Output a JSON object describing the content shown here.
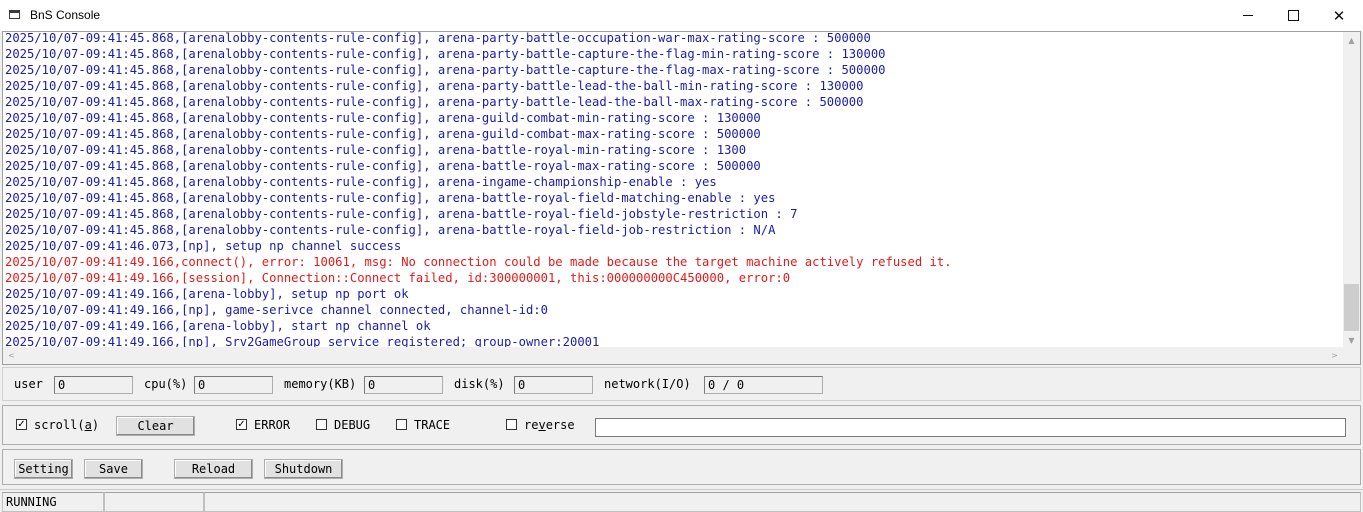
{
  "window": {
    "title": "BnS Console",
    "minimize_icon": "minimize-icon",
    "maximize_icon": "maximize-icon",
    "close_icon": "close-icon",
    "close_glyph": "✕"
  },
  "log": {
    "lines": [
      {
        "text": "2025/10/07-09:41:45.868,[arenalobby-contents-rule-config], arena-party-battle-occupation-war-max-rating-score : 500000",
        "level": "info"
      },
      {
        "text": "2025/10/07-09:41:45.868,[arenalobby-contents-rule-config], arena-party-battle-capture-the-flag-min-rating-score : 130000",
        "level": "info"
      },
      {
        "text": "2025/10/07-09:41:45.868,[arenalobby-contents-rule-config], arena-party-battle-capture-the-flag-max-rating-score : 500000",
        "level": "info"
      },
      {
        "text": "2025/10/07-09:41:45.868,[arenalobby-contents-rule-config], arena-party-battle-lead-the-ball-min-rating-score : 130000",
        "level": "info"
      },
      {
        "text": "2025/10/07-09:41:45.868,[arenalobby-contents-rule-config], arena-party-battle-lead-the-ball-max-rating-score : 500000",
        "level": "info"
      },
      {
        "text": "2025/10/07-09:41:45.868,[arenalobby-contents-rule-config], arena-guild-combat-min-rating-score : 130000",
        "level": "info"
      },
      {
        "text": "2025/10/07-09:41:45.868,[arenalobby-contents-rule-config], arena-guild-combat-max-rating-score : 500000",
        "level": "info"
      },
      {
        "text": "2025/10/07-09:41:45.868,[arenalobby-contents-rule-config], arena-battle-royal-min-rating-score : 1300",
        "level": "info"
      },
      {
        "text": "2025/10/07-09:41:45.868,[arenalobby-contents-rule-config], arena-battle-royal-max-rating-score : 500000",
        "level": "info"
      },
      {
        "text": "2025/10/07-09:41:45.868,[arenalobby-contents-rule-config], arena-ingame-championship-enable : yes",
        "level": "info"
      },
      {
        "text": "2025/10/07-09:41:45.868,[arenalobby-contents-rule-config], arena-battle-royal-field-matching-enable : yes",
        "level": "info"
      },
      {
        "text": "2025/10/07-09:41:45.868,[arenalobby-contents-rule-config], arena-battle-royal-field-jobstyle-restriction : 7",
        "level": "info"
      },
      {
        "text": "2025/10/07-09:41:45.868,[arenalobby-contents-rule-config], arena-battle-royal-field-job-restriction : N/A",
        "level": "info"
      },
      {
        "text": "2025/10/07-09:41:46.073,[np], setup np channel success",
        "level": "info"
      },
      {
        "text": "2025/10/07-09:41:49.166,connect(), error: 10061, msg: No connection could be made because the target machine actively refused it.",
        "level": "error"
      },
      {
        "text": "2025/10/07-09:41:49.166,[session], Connection::Connect failed, id:300000001, this:000000000C450000, error:0",
        "level": "error"
      },
      {
        "text": "2025/10/07-09:41:49.166,[arena-lobby], setup np port ok",
        "level": "info"
      },
      {
        "text": "2025/10/07-09:41:49.166,[np], game-serivce channel connected, channel-id:0",
        "level": "info"
      },
      {
        "text": "2025/10/07-09:41:49.166,[arena-lobby], start np channel ok",
        "level": "info"
      },
      {
        "text": "2025/10/07-09:41:49.166,[np], Srv2GameGroup service registered; group-owner:20001",
        "level": "info"
      }
    ],
    "colors": {
      "info": "#1c1caa",
      "error": "#e21b1b"
    },
    "scroll_up_icon": "▲",
    "scroll_down_icon": "▼",
    "scroll_left_icon": "<",
    "scroll_right_icon": ">"
  },
  "stats": {
    "user_label": "user",
    "user_value": "0",
    "cpu_label": "cpu(%)",
    "cpu_value": "0",
    "memory_label": "memory(KB)",
    "memory_value": "0",
    "disk_label": "disk(%)",
    "disk_value": "0",
    "network_label": "network(I/O)",
    "network_value": "0 / 0"
  },
  "options": {
    "scroll_label_pre": "scroll(",
    "scroll_label_key": "a",
    "scroll_label_post": ")",
    "scroll_checked": true,
    "clear_label": "Clear",
    "error_label": "ERROR",
    "error_checked": true,
    "debug_label": "DEBUG",
    "debug_checked": false,
    "trace_label": "TRACE",
    "trace_checked": false,
    "reverse_label_pre": "re",
    "reverse_label_key": "v",
    "reverse_label_post": "erse",
    "reverse_checked": false,
    "filter_value": "",
    "check_glyph": "✓"
  },
  "actions": {
    "setting_label": "Setting",
    "save_label": "Save",
    "reload_label": "Reload",
    "shutdown_label": "Shutdown"
  },
  "status": {
    "state": "RUNNING",
    "cell2": ""
  }
}
